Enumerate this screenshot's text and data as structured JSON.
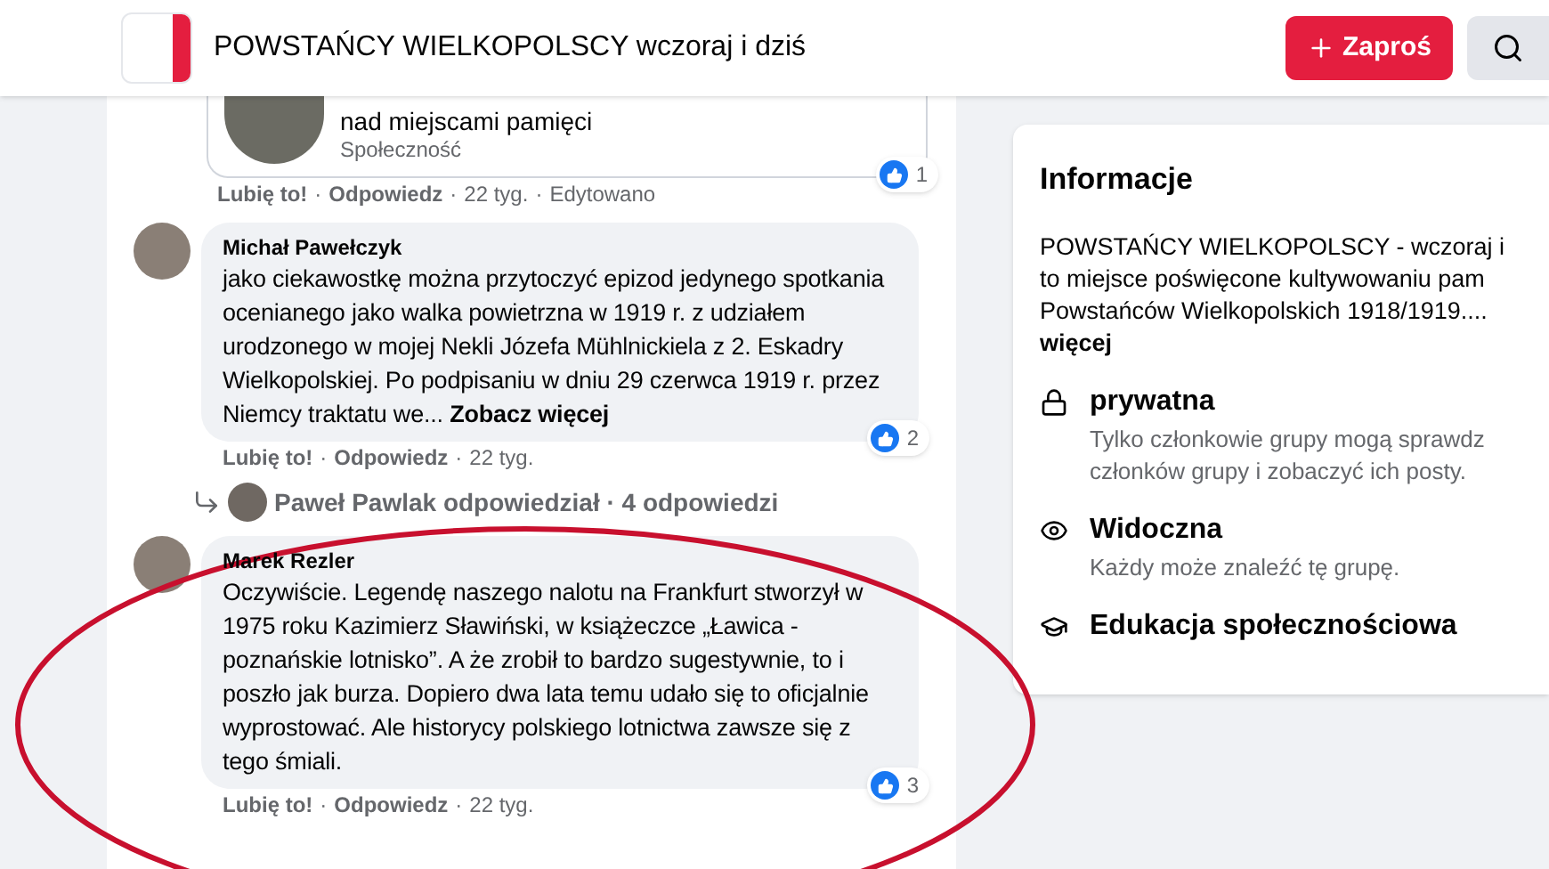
{
  "header": {
    "group_title": "POWSTAŃCY WIELKOPOLSCY wczoraj i dziś",
    "invite_button": "Zaproś"
  },
  "shared_card": {
    "title": "nad miejscami pamięci",
    "subtitle": "Społeczność",
    "actions": {
      "like": "Lubię to!",
      "sep": "·",
      "reply": "Odpowiedz",
      "time": "22 tyg.",
      "edited": "Edytowano"
    },
    "reactions": "1"
  },
  "comments": [
    {
      "author": "Michał Pawełczyk",
      "text": "jako ciekawostkę można przytoczyć epizod jedynego spotkania ocenianego jako walka powietrzna w 1919 r. z udziałem urodzonego w mojej Nekli Józefa Mühlnickiela z 2. Eskadry Wielkopolskiej. Po podpisaniu w dniu 29 czerwca 1919 r. przez Niemcy traktatu we...",
      "see_more": "Zobacz więcej",
      "reactions": "2",
      "actions": {
        "like": "Lubię to!",
        "sep": "·",
        "reply": "Odpowiedz",
        "time": "22 tyg."
      },
      "replies_summary": "Paweł Pawlak odpowiedział · 4 odpowiedzi"
    },
    {
      "author": "Marek Rezler",
      "text": "Oczywiście. Legendę naszego nalotu na Frankfurt stworzył w 1975 roku Kazimierz Sławiński, w książeczce „Ławica - poznańskie lotnisko”. A że zrobił to bardzo sugestywnie, to i poszło jak burza. Dopiero dwa lata temu udało się to oficjalnie wyprostować. Ale historycy polskiego lotnictwa zawsze się z tego śmiali.",
      "reactions": "3",
      "actions": {
        "like": "Lubię to!",
        "sep": "·",
        "reply": "Odpowiedz",
        "time": "22 tyg."
      }
    }
  ],
  "info": {
    "title": "Informacje",
    "description": "POWSTAŃCY WIELKOPOLSCY - wczoraj i",
    "description_2": "to miejsce poświęcone kultywowaniu pam",
    "description_3": "Powstańców Wielkopolskich 1918/1919....",
    "see_more": "więcej",
    "items": [
      {
        "kind": "lock",
        "title": "prywatna",
        "text": "Tylko członkowie grupy mogą sprawdz",
        "text_2": "członków grupy i zobaczyć ich posty."
      },
      {
        "kind": "eye",
        "title": "Widoczna",
        "text": "Każdy może znaleźć tę grupę."
      },
      {
        "kind": "education",
        "title": "Edukacja społecznościowa"
      }
    ]
  }
}
